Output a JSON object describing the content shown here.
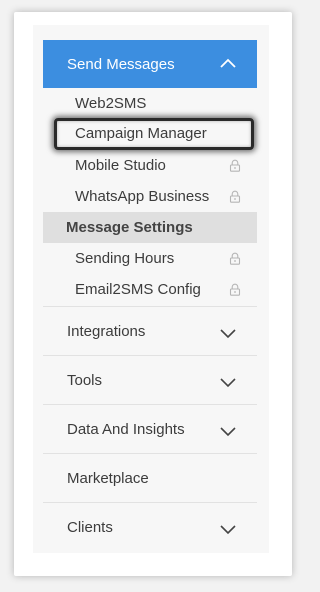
{
  "menu": {
    "header": {
      "label": "Send Messages",
      "icon": "chevron-up-icon",
      "color": "#3c8ee0"
    },
    "sub_items": [
      {
        "label": "Web2SMS",
        "locked": false
      },
      {
        "label": "Campaign Manager",
        "locked": false,
        "highlighted": true
      },
      {
        "label": "Mobile Studio",
        "locked": true
      },
      {
        "label": "WhatsApp Business",
        "locked": true
      }
    ],
    "section_label": "Message Settings",
    "settings_items": [
      {
        "label": "Sending Hours",
        "locked": true
      },
      {
        "label": "Email2SMS Config",
        "locked": true
      }
    ],
    "top_items": [
      {
        "label": "Integrations",
        "has_chevron": true
      },
      {
        "label": "Tools",
        "has_chevron": true
      },
      {
        "label": "Data And Insights",
        "has_chevron": true
      },
      {
        "label": "Marketplace",
        "has_chevron": false
      },
      {
        "label": "Clients",
        "has_chevron": true
      }
    ]
  }
}
